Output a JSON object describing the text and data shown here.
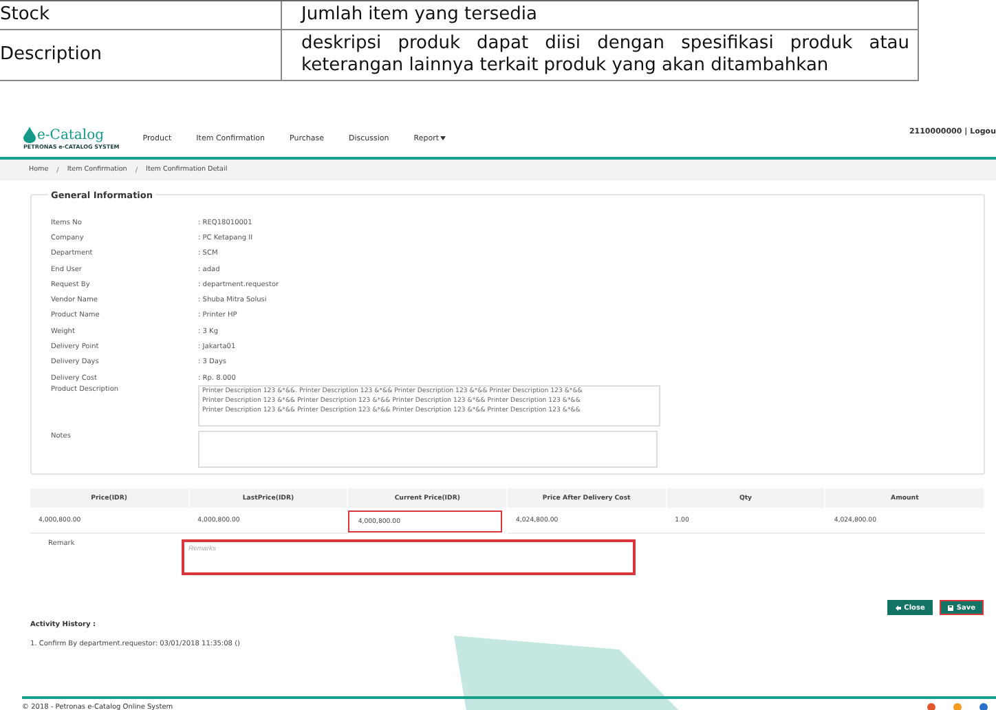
{
  "doc_table": {
    "rows": [
      {
        "field": "Stock",
        "description": "Jumlah item yang tersedia"
      },
      {
        "field": "Description",
        "description": "deskripsi produk dapat diisi dengan spesifikasi produk atau keterangan lainnya terkait produk yang akan ditambahkan"
      }
    ]
  },
  "app": {
    "logo": {
      "name": "e-Catalog",
      "tagline": "PETRONAS e-CATALOG SYSTEM"
    },
    "menu": [
      {
        "label": "Product",
        "dropdown": false
      },
      {
        "label": "Item Confirmation",
        "dropdown": false
      },
      {
        "label": "Purchase",
        "dropdown": false
      },
      {
        "label": "Discussion",
        "dropdown": false
      },
      {
        "label": "Report",
        "dropdown": true
      }
    ],
    "user": "2110000000",
    "user_separator": "|",
    "logout": "Logou",
    "breadcrumb": [
      "Home",
      "Item Confirmation",
      "Item Confirmation Detail"
    ],
    "breadcrumb_separator": "/",
    "section_title": "General Information",
    "fields": [
      {
        "label": "Items No",
        "value": ": REQ18010001"
      },
      {
        "label": "Company",
        "value": ": PC Ketapang II"
      },
      {
        "label": "Department",
        "value": ": SCM"
      },
      {
        "label": "End User",
        "value": ": adad"
      },
      {
        "label": "Request By",
        "value": ": department.requestor"
      },
      {
        "label": "Vendor Name",
        "value": ": Shuba Mitra Solusi"
      },
      {
        "label": "Product Name",
        "value": ": Printer HP"
      },
      {
        "label": "Weight",
        "value": ": 3 Kg"
      },
      {
        "label": "Delivery Point",
        "value": ": Jakarta01"
      },
      {
        "label": "Delivery Days",
        "value": ": 3 Days"
      },
      {
        "label": "Delivery Cost",
        "value": ": Rp. 8.000"
      }
    ],
    "product_description": {
      "label": "Product Description",
      "lines": [
        "Printer Description 123 &*&&. Printer Description 123 &*&& Printer Description 123 &*&& Printer Description 123 &*&&",
        "Printer Description 123 &*&& Printer Description 123 &*&& Printer Description 123 &*&& Printer Description 123 &*&&",
        "Printer Description 123 &*&& Printer Description 123 &*&& Printer Description 123 &*&& Printer Description 123 &*&&"
      ]
    },
    "notes": {
      "label": "Notes"
    },
    "price_table": {
      "columns": [
        "Price(IDR)",
        "LastPrice(IDR)",
        "Current Price(IDR)",
        "Price After Delivery Cost",
        "Qty",
        "Amount"
      ],
      "row": [
        {
          "value": "4,000,800.00",
          "highlighted": false
        },
        {
          "value": "4,000,800.00",
          "highlighted": false
        },
        {
          "value": "4,000,800.00",
          "highlighted": true
        },
        {
          "value": "4,024,800.00",
          "highlighted": false
        },
        {
          "value": "1.00",
          "highlighted": false
        },
        {
          "value": "4,024,800.00",
          "highlighted": false
        }
      ]
    },
    "remark": {
      "label": "Remark",
      "placeholder": "Remarks",
      "highlighted": true
    },
    "buttons": [
      {
        "label": "Close",
        "kind": "close",
        "highlighted": false
      },
      {
        "label": "Save",
        "kind": "save",
        "highlighted": true
      }
    ],
    "activity_title": "Activity History :",
    "activity": [
      "1. Confirm By department.requestor: 03/01/2018 11:35:08 ()"
    ],
    "footer": "© 2018 - Petronas e-Catalog Online System"
  }
}
